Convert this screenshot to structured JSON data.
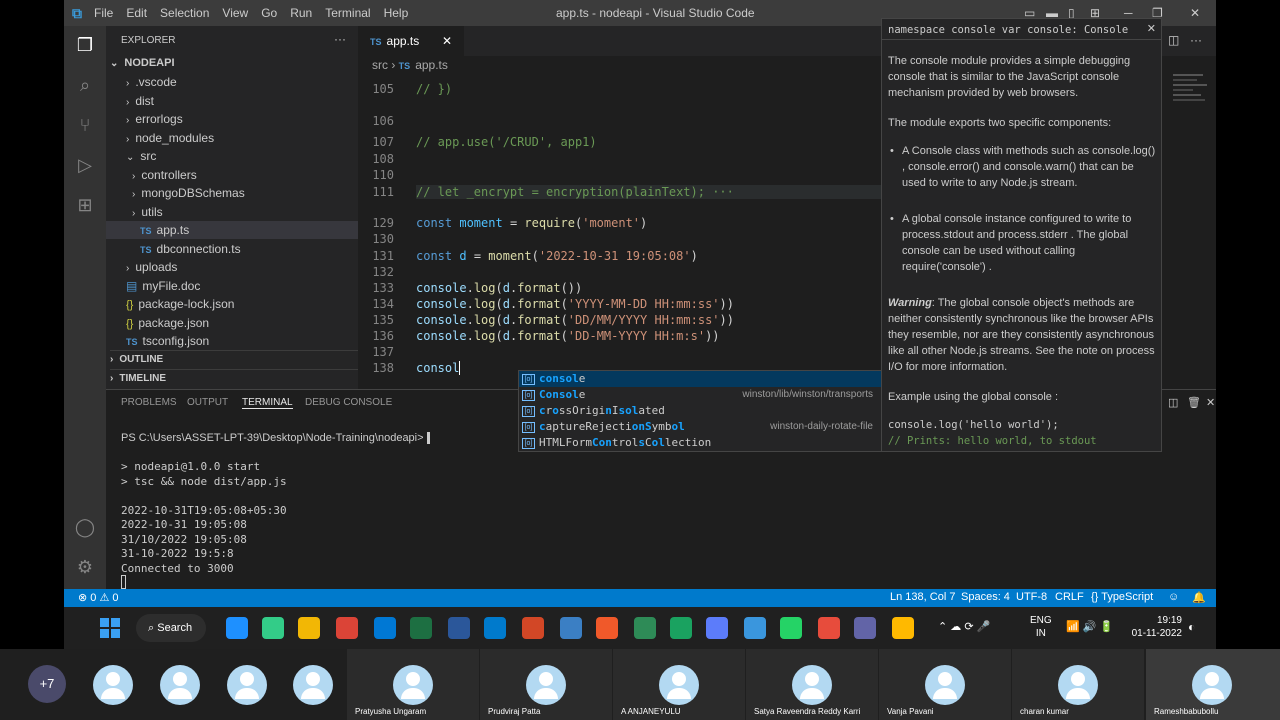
{
  "titlebar": {
    "menus": [
      "File",
      "Edit",
      "Selection",
      "View",
      "Go",
      "Run",
      "Terminal",
      "Help"
    ],
    "title": "app.ts - nodeapi - Visual Studio Code"
  },
  "sidebar": {
    "header": "EXPLORER",
    "root": "NODEAPI",
    "items": [
      {
        "label": ".vscode",
        "kind": "folder",
        "depth": 1
      },
      {
        "label": "dist",
        "kind": "folder",
        "depth": 1
      },
      {
        "label": "errorlogs",
        "kind": "folder",
        "depth": 1
      },
      {
        "label": "node_modules",
        "kind": "folder",
        "depth": 1
      },
      {
        "label": "src",
        "kind": "folder-open",
        "depth": 1
      },
      {
        "label": "controllers",
        "kind": "folder",
        "depth": 2
      },
      {
        "label": "mongoDBSchemas",
        "kind": "folder",
        "depth": 2
      },
      {
        "label": "utils",
        "kind": "folder",
        "depth": 2
      },
      {
        "label": "app.ts",
        "kind": "ts",
        "depth": 2
      },
      {
        "label": "dbconnection.ts",
        "kind": "ts",
        "depth": 2
      },
      {
        "label": "uploads",
        "kind": "folder",
        "depth": 1
      },
      {
        "label": "myFile.doc",
        "kind": "file",
        "depth": 1
      },
      {
        "label": "package-lock.json",
        "kind": "json",
        "depth": 1
      },
      {
        "label": "package.json",
        "kind": "json",
        "depth": 1
      },
      {
        "label": "tsconfig.json",
        "kind": "ts",
        "depth": 1
      }
    ],
    "outline": "OUTLINE",
    "timeline": "TIMELINE"
  },
  "editor": {
    "tab": "app.ts",
    "breadcrumb": [
      "src",
      "app.ts"
    ],
    "lines": [
      {
        "n": "105",
        "t": "// })",
        "c": "cm"
      },
      {
        "n": "106",
        "t": "",
        "c": ""
      },
      {
        "n": "107",
        "t": "// app.use('/CRUD', app1)",
        "c": "cm"
      },
      {
        "n": "108",
        "t": "",
        "c": ""
      },
      {
        "n": "110",
        "t": "",
        "c": ""
      },
      {
        "n": "111",
        "t": "// let _encrypt = encryption(plainText); ···",
        "c": "cm"
      },
      {
        "n": "129",
        "t": "const moment = require('moment')",
        "c": "mix1"
      },
      {
        "n": "130",
        "t": "",
        "c": ""
      },
      {
        "n": "131",
        "t": "const d = moment('2022-10-31 19:05:08')",
        "c": "mix2"
      },
      {
        "n": "132",
        "t": "",
        "c": ""
      },
      {
        "n": "133",
        "t": "console.log(d.format())",
        "c": "mix3"
      },
      {
        "n": "134",
        "t": "console.log(d.format('YYYY-MM-DD HH:mm:ss'))",
        "c": "mix3"
      },
      {
        "n": "135",
        "t": "console.log(d.format('DD/MM/YYYY HH:mm:ss'))",
        "c": "mix3"
      },
      {
        "n": "136",
        "t": "console.log(d.format('DD-MM-YYYY HH:m:s'))",
        "c": "mix3"
      },
      {
        "n": "137",
        "t": "",
        "c": ""
      },
      {
        "n": "138",
        "t": "consol",
        "c": "plain"
      }
    ]
  },
  "suggest": [
    {
      "label": "console",
      "detail": ""
    },
    {
      "label": "Console",
      "detail": "winston/lib/winston/transports"
    },
    {
      "label": "crossOriginIsolated",
      "detail": ""
    },
    {
      "label": "captureRejectionSymbol",
      "detail": "winston-daily-rotate-file"
    },
    {
      "label": "HTMLFormControlsCollection",
      "detail": ""
    }
  ],
  "hover": {
    "signature": "namespace console var console: Console",
    "p1": "The console module provides a simple debugging console that is similar to the JavaScript console mechanism provided by web browsers.",
    "p2": "The module exports two specific components:",
    "b1": "A Console class with methods such as console.log() , console.error() and console.warn() that can be used to write to any Node.js stream.",
    "b2": "A global console instance configured to write to process.stdout and process.stderr . The global console can be used without calling require('console') .",
    "warn_label": "Warning",
    "warn": ": The global console object's methods are neither consistently synchronous like the browser APIs they resemble, nor are they consistently asynchronous like all other Node.js streams. See the note on process I/O for more information.",
    "p4": "Example using the global console :",
    "ex1": "console.log('hello world');",
    "ex2": "// Prints: hello world, to stdout"
  },
  "panel": {
    "tabs": [
      "PROBLEMS",
      "OUTPUT",
      "TERMINAL",
      "DEBUG CONSOLE"
    ],
    "prompt": "PS C:\\Users\\ASSET-LPT-39\\Desktop\\Node-Training\\nodeapi>",
    "out": [
      "> nodeapi@1.0.0 start",
      "> tsc && node dist/app.js",
      "",
      "2022-10-31T19:05:08+05:30",
      "2022-10-31 19:05:08",
      "31/10/2022 19:05:08",
      "31-10-2022 19:5:8",
      "Connected to 3000"
    ]
  },
  "status": {
    "problems": "⊗ 0 ⚠ 0",
    "pos": "Ln 138, Col 7",
    "spaces": "Spaces: 4",
    "enc": "UTF-8",
    "eol": "CRLF",
    "lang": "{} TypeScript"
  },
  "taskbar": {
    "search": "Search",
    "lang1": "ENG",
    "lang2": "IN",
    "time": "19:19",
    "date": "01-11-2022"
  },
  "meeting": {
    "more": "+7",
    "names": [
      "Pratyusha Ungaram",
      "Prudviraj Patta",
      "A ANJANEYULU",
      "Satya Raveendra Reddy Karri",
      "Vanja Pavani",
      "charan kumar",
      "Rameshbabubollu"
    ]
  }
}
